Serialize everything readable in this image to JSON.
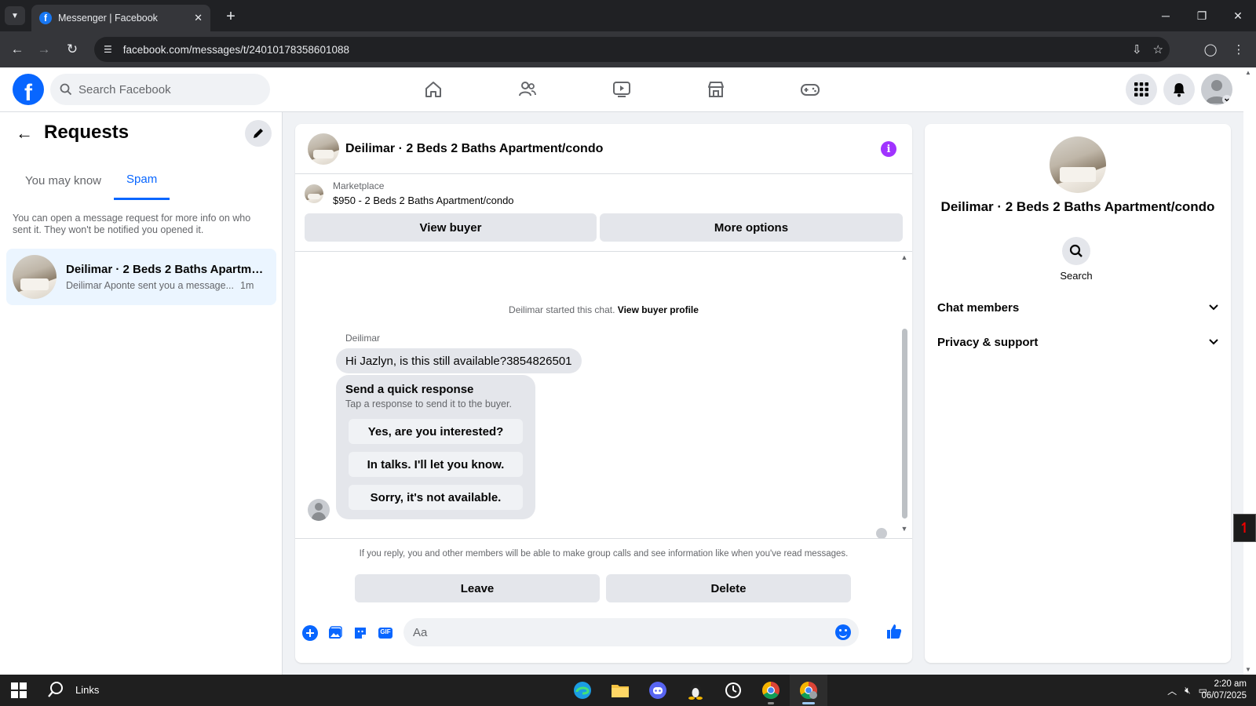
{
  "browser": {
    "tab_title": "Messenger | Facebook",
    "url": "facebook.com/messages/t/24010178358601088",
    "tab_close": "✕",
    "new_tab": "+"
  },
  "fbnav": {
    "search_placeholder": "Search Facebook",
    "logo_letter": "f"
  },
  "left": {
    "title": "Requests",
    "tabs": [
      {
        "label": "You may know",
        "active": false
      },
      {
        "label": "Spam",
        "active": true
      }
    ],
    "note": "You can open a message request for more info on who sent it. They won't be notified you opened it.",
    "conversation": {
      "name": "Deilimar · 2 Beds 2 Baths Apartme...",
      "snippet": "Deilimar Aponte sent you a message...",
      "time": "1m"
    }
  },
  "chat": {
    "title": "Deilimar · 2 Beds 2 Baths Apartment/condo",
    "market_label": "Marketplace",
    "market_item": "$950 - 2 Beds 2 Baths Apartment/condo",
    "view_buyer": "View buyer",
    "more_options": "More options",
    "started_text": "Deilimar started this chat.",
    "started_link": "View buyer profile",
    "sender": "Deilimar",
    "message": "Hi Jazlyn, is this still available?3854826501",
    "quick_title": "Send a quick response",
    "quick_sub": "Tap a response to send it to the buyer.",
    "quick_responses": [
      "Yes, are you interested?",
      "In talks. I'll let you know.",
      "Sorry, it's not available."
    ],
    "reply_note": "If you reply, you and other members will be able to make group calls and see information like when you've read messages.",
    "leave": "Leave",
    "delete": "Delete",
    "input_placeholder": "Aa",
    "gif_label": "GIF"
  },
  "right": {
    "name": "Deilimar · 2 Beds 2 Baths Apartment/condo",
    "search_label": "Search",
    "sections": [
      "Chat members",
      "Privacy & support"
    ]
  },
  "taskbar": {
    "search_label": "Links",
    "time": "2:20 am",
    "date": "06/07/2025"
  },
  "colors": {
    "accent": "#0866ff",
    "info": "#a033ff",
    "selected_bg": "#ebf5ff"
  }
}
